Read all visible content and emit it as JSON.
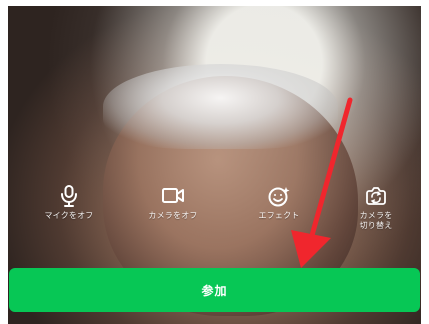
{
  "call_controls": [
    {
      "icon": "microphone-icon",
      "label": "マイクをオフ"
    },
    {
      "icon": "video-camera-icon",
      "label": "カメラをオフ"
    },
    {
      "icon": "smile-sparkle-icon",
      "label": "エフェクト"
    },
    {
      "icon": "camera-switch-icon",
      "label": "カメラを\n切り替え"
    }
  ],
  "join_button": {
    "label": "参加"
  },
  "colors": {
    "join_button_background": "#07c755",
    "control_text": "#ffffff",
    "arrow": "#f0262d"
  }
}
